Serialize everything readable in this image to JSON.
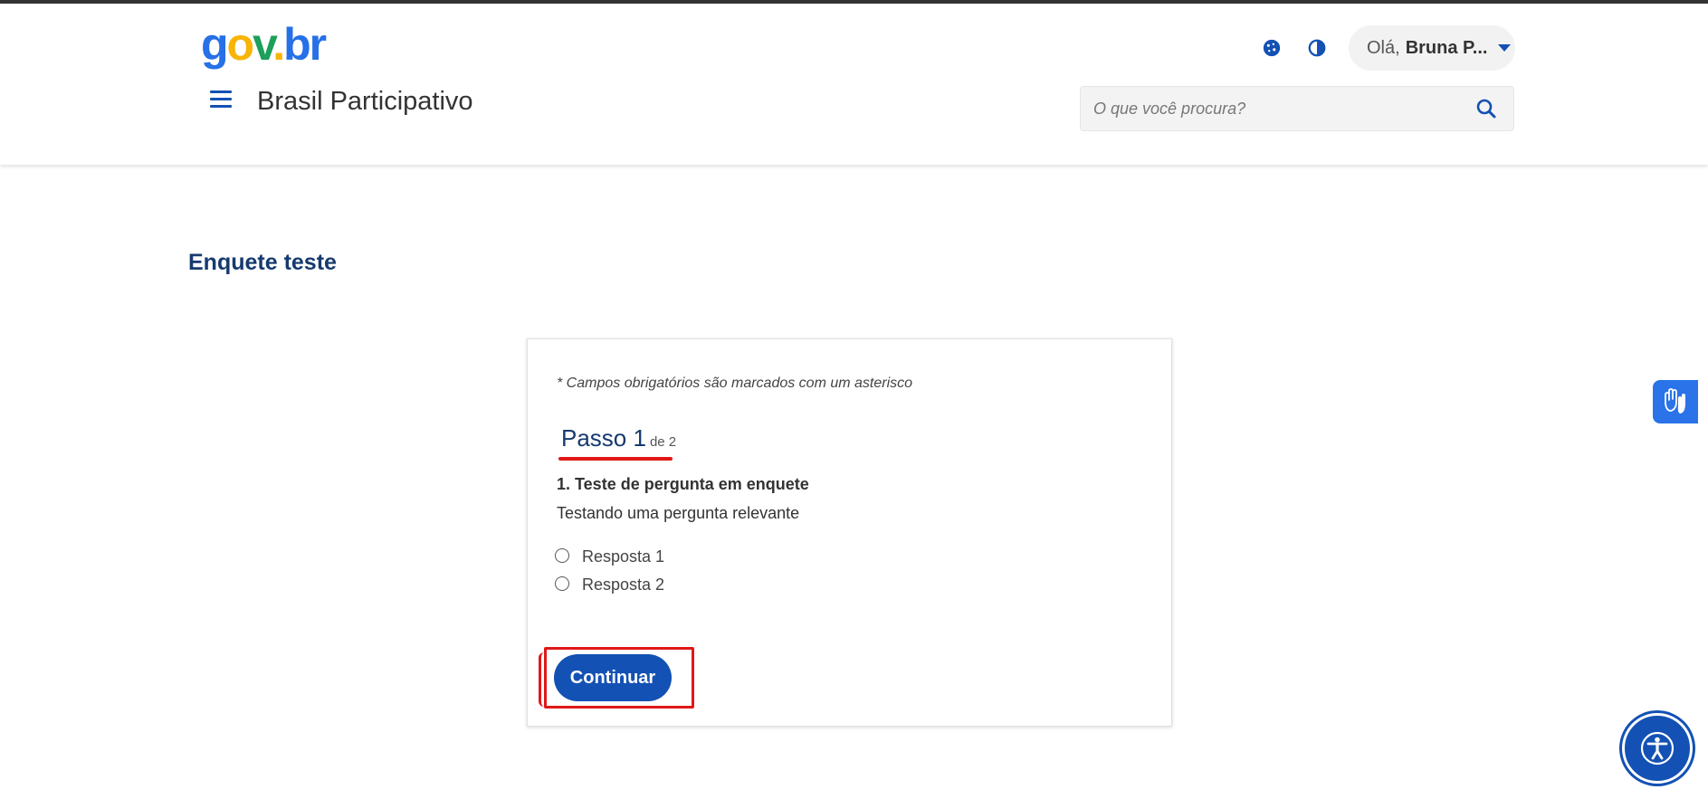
{
  "header": {
    "logo": {
      "g": "g",
      "o": "o",
      "v": "v",
      "dot": ".",
      "b": "b",
      "r": "r"
    },
    "site_title": "Brasil Participativo",
    "user": {
      "greeting": "Olá,",
      "name": "Bruna P..."
    },
    "search": {
      "placeholder": "O que você procura?"
    },
    "icons": {
      "menu": "hamburger-icon",
      "cookie": "cookie-icon",
      "contrast": "contrast-icon",
      "search": "search-icon",
      "user_caret": "caret-down-icon"
    }
  },
  "page": {
    "title": "Enquete teste"
  },
  "form": {
    "required_note": "* Campos obrigatórios são marcados com um asterisco",
    "step": {
      "main": "Passo 1",
      "sub": "de 2"
    },
    "question": {
      "title": "1. Teste de pergunta em enquete",
      "description": "Testando uma pergunta relevante",
      "options": [
        {
          "label": "Resposta 1"
        },
        {
          "label": "Resposta 2"
        }
      ]
    },
    "continue_label": "Continuar"
  },
  "floating": {
    "vlibras_icon": "sign-language-hands-icon",
    "accessibility_icon": "accessibility-person-icon"
  },
  "colors": {
    "primary": "#1351b4",
    "heading": "#163a6f",
    "annotation_red": "#e01818"
  }
}
